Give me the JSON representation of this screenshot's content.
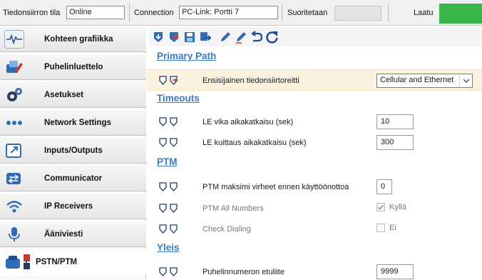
{
  "status_bar": {
    "transfer_state_label": "Tiedonsiirron tila",
    "transfer_state_value": "Online",
    "connection_label": "Connection",
    "connection_value": "PC-Link: Portti 7",
    "running_label": "Suoritetaan",
    "running_value": "",
    "quality_label": "Laatu",
    "quality_color": "#3ab54a"
  },
  "sidebar": {
    "items": [
      {
        "label": "Kohteen grafiikka",
        "icon": "waveform-icon"
      },
      {
        "label": "Puhelinluettelo",
        "icon": "phonebook-icon"
      },
      {
        "label": "Asetukset",
        "icon": "gears-icon"
      },
      {
        "label": "Network Settings",
        "icon": "dots-icon"
      },
      {
        "label": "Inputs/Outputs",
        "icon": "io-arrow-icon"
      },
      {
        "label": "Communicator",
        "icon": "arrows-exchange-icon"
      },
      {
        "label": "IP Receivers",
        "icon": "wifi-icon"
      },
      {
        "label": "Ääniviesti",
        "icon": "microphone-icon"
      },
      {
        "label": "PSTN/PTM",
        "icon": "phone-cable-icon"
      }
    ],
    "active_index": 8
  },
  "toolbar": {
    "buttons": [
      "read-icon",
      "write-icon",
      "save-icon",
      "transfer-icon",
      "edit-icon",
      "edit-alt-icon",
      "undo-icon",
      "refresh-icon"
    ]
  },
  "sections": {
    "primary_path": "Primary Path",
    "timeouts": "Timeouts",
    "ptm": "PTM",
    "general": "Yleis"
  },
  "fields": {
    "primary_route": {
      "label": "Ensisijainen tiedonsiirtoreitti",
      "value": "Cellular and Ethernet"
    },
    "le_fault_timeout": {
      "label": "LE vika aikakatkaisu (sek)",
      "value": "10"
    },
    "le_ack_timeout": {
      "label": "LE kuittaus aikakatkaisu (sek)",
      "value": "300"
    },
    "ptm_max_errors": {
      "label": "PTM maksimi virheet ennen käyttöönottoa",
      "value": "0"
    },
    "ptm_all_numbers": {
      "label": "PTM All Numbers",
      "value": "Kyllä",
      "checked": true
    },
    "check_dialing": {
      "label": "Check Dialing",
      "value": "Ei",
      "checked": false
    },
    "phone_prefix": {
      "label": "Puhelinnumeron etuliite",
      "value": "9999"
    }
  }
}
